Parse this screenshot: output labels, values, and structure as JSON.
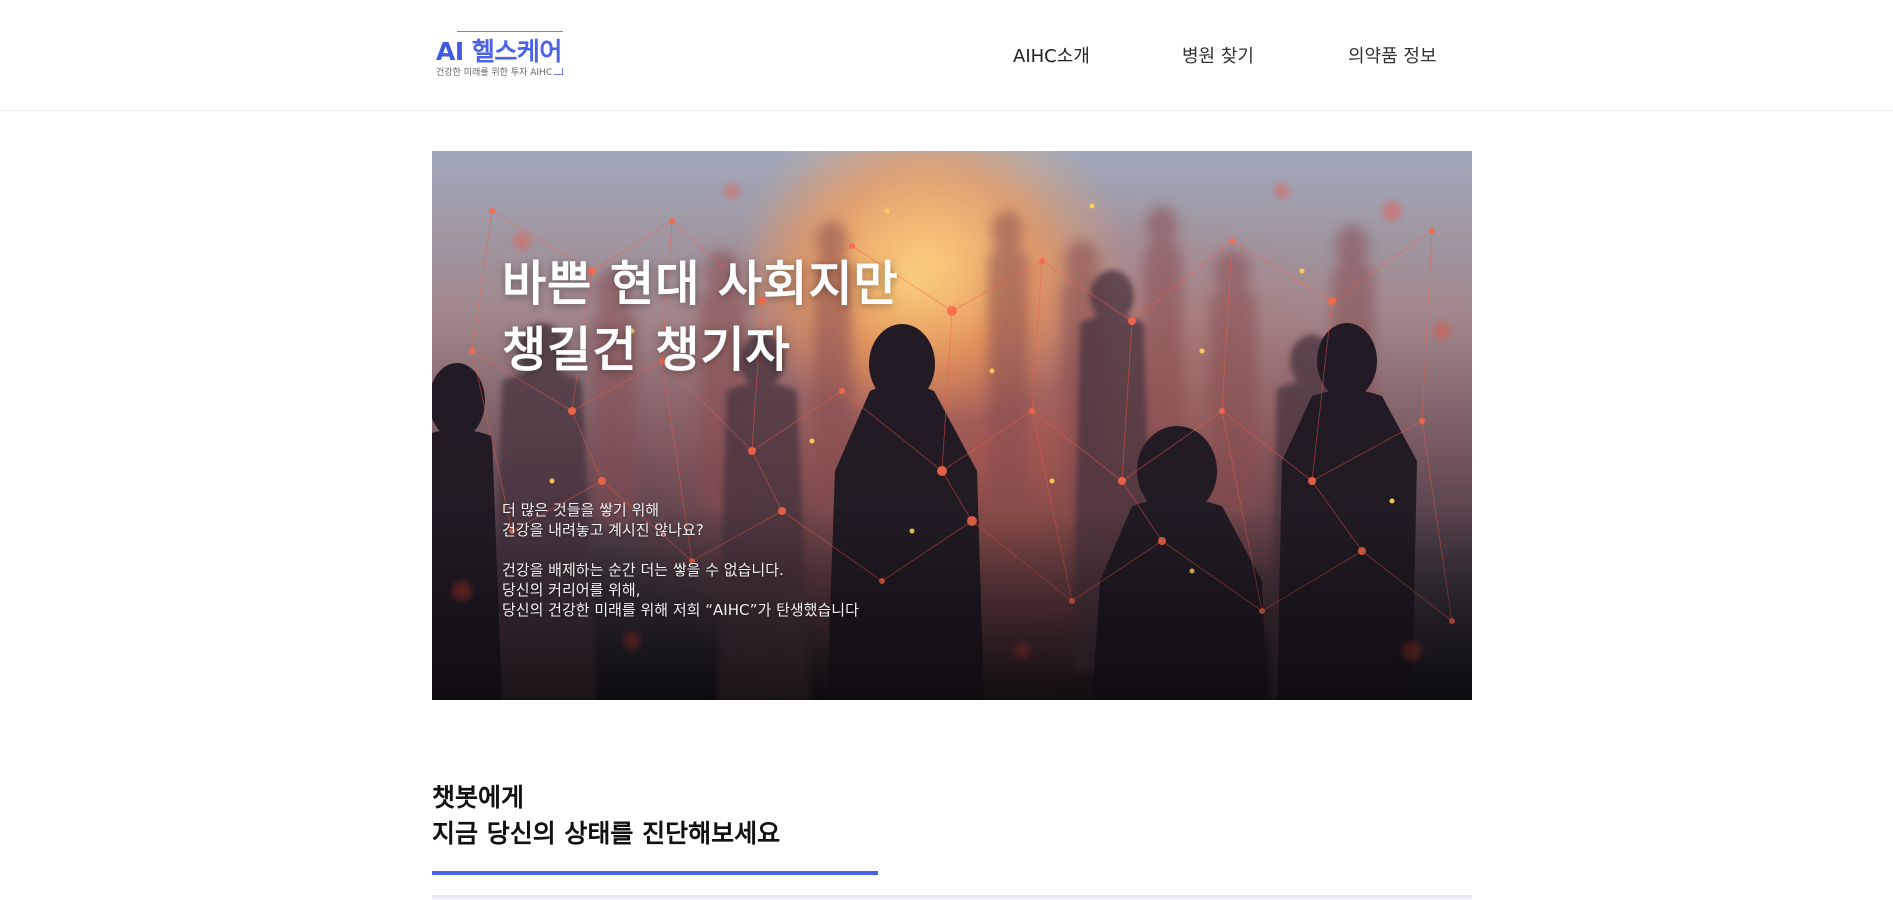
{
  "header": {
    "logo": {
      "ai_text": "AI",
      "brand_text": "헬스케어",
      "tagline": "건강한 미래를 위한 투자 AIHC",
      "accent_color": "#4b63e6"
    },
    "nav": [
      {
        "label": "AIHC소개"
      },
      {
        "label": "병원 찾기"
      },
      {
        "label": "의약품 정보"
      }
    ]
  },
  "hero": {
    "title_line1": "바쁜 현대 사회지만",
    "title_line2": "챙길건 챙기자",
    "body": [
      "더 많은 것들을 쌓기 위해",
      "건강을 내려놓고 계시진 않나요?",
      "",
      "건강을 배제하는 순간 더는 쌓을 수 없습니다.",
      "당신의 커리어를 위해,",
      "당신의 건강한 미래를 위해 저희 “AIHC”가 탄생했습니다"
    ],
    "image_description_icon": "people-network-image"
  },
  "chatbot_section": {
    "title_line1": "챗봇에게",
    "title_line2": "지금 당신의 상태를 진단해보세요",
    "underline_color": "#4b63e6"
  }
}
